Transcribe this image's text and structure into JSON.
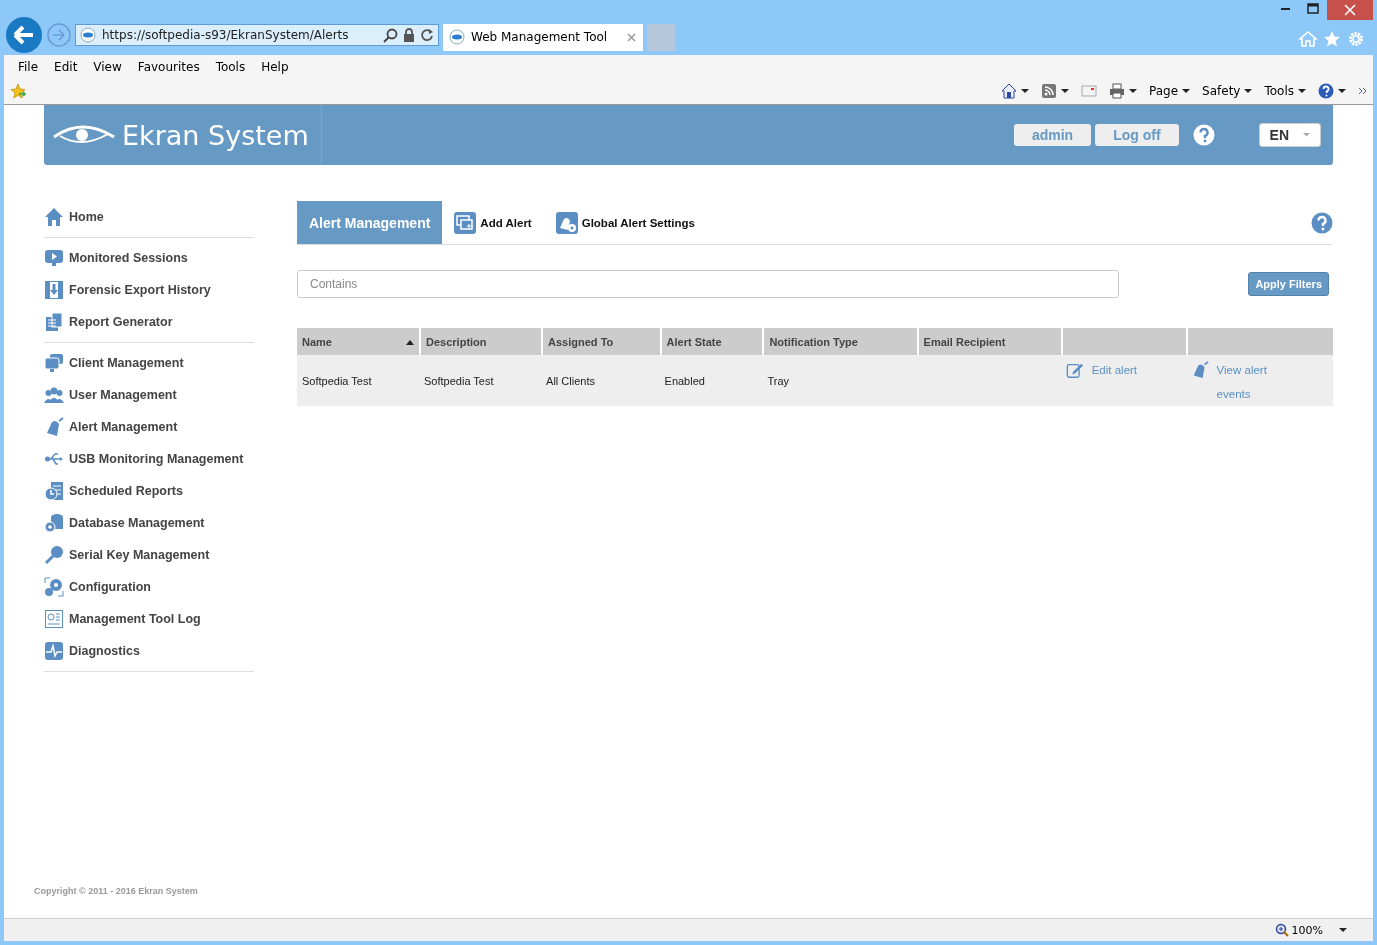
{
  "browser": {
    "address": "https://softpedia-s93/EkranSystem/Alerts",
    "tab_title": "Web Management Tool",
    "menu": [
      "File",
      "Edit",
      "View",
      "Favourites",
      "Tools",
      "Help"
    ],
    "commands": [
      "Page",
      "Safety",
      "Tools"
    ],
    "zoom": "100%"
  },
  "header": {
    "logo": "Ekran System",
    "user": "admin",
    "logoff": "Log off",
    "language": "EN"
  },
  "sidebar": {
    "groups": [
      {
        "items": [
          {
            "label": "Home",
            "kind": "home"
          }
        ]
      },
      {
        "items": [
          {
            "label": "Monitored Sessions",
            "kind": "monitor"
          },
          {
            "label": "Forensic Export History",
            "kind": "film"
          },
          {
            "label": "Report Generator",
            "kind": "report"
          }
        ]
      },
      {
        "items": [
          {
            "label": "Client Management",
            "kind": "client"
          },
          {
            "label": "User Management",
            "kind": "users"
          },
          {
            "label": "Alert Management",
            "kind": "bell"
          },
          {
            "label": "USB Monitoring Management",
            "kind": "usb"
          },
          {
            "label": "Scheduled Reports",
            "kind": "clock"
          },
          {
            "label": "Database Management",
            "kind": "database"
          },
          {
            "label": "Serial Key Management",
            "kind": "key"
          },
          {
            "label": "Configuration",
            "kind": "gear"
          },
          {
            "label": "Management Tool Log",
            "kind": "log"
          },
          {
            "label": "Diagnostics",
            "kind": "pulse"
          }
        ]
      }
    ]
  },
  "tabs": [
    {
      "label": "Alert Management",
      "selected": true
    },
    {
      "label": "Add Alert",
      "selected": false,
      "kind": "add"
    },
    {
      "label": "Global Alert Settings",
      "selected": false,
      "kind": "settings"
    }
  ],
  "filter": {
    "placeholder": "Contains",
    "button": "Apply Filters"
  },
  "table": {
    "columns": [
      {
        "label": "Name",
        "sorted": true
      },
      {
        "label": "Description",
        "sorted": false
      },
      {
        "label": "Assigned To",
        "sorted": false
      },
      {
        "label": "Alert State",
        "sorted": false
      },
      {
        "label": "Notification Type",
        "sorted": false
      },
      {
        "label": "Email Recipient",
        "sorted": false
      }
    ],
    "rows": [
      {
        "cells": [
          "Softpedia Test",
          "Softpedia Test",
          "All Clients",
          "Enabled",
          "Tray"
        ],
        "actions": [
          {
            "kind": "edit",
            "label": "Edit alert"
          },
          {
            "kind": "view",
            "label": "View alert events"
          }
        ]
      }
    ]
  },
  "footer": {
    "copyright": "Copyright © 2011 - 2016 Ekran System"
  }
}
